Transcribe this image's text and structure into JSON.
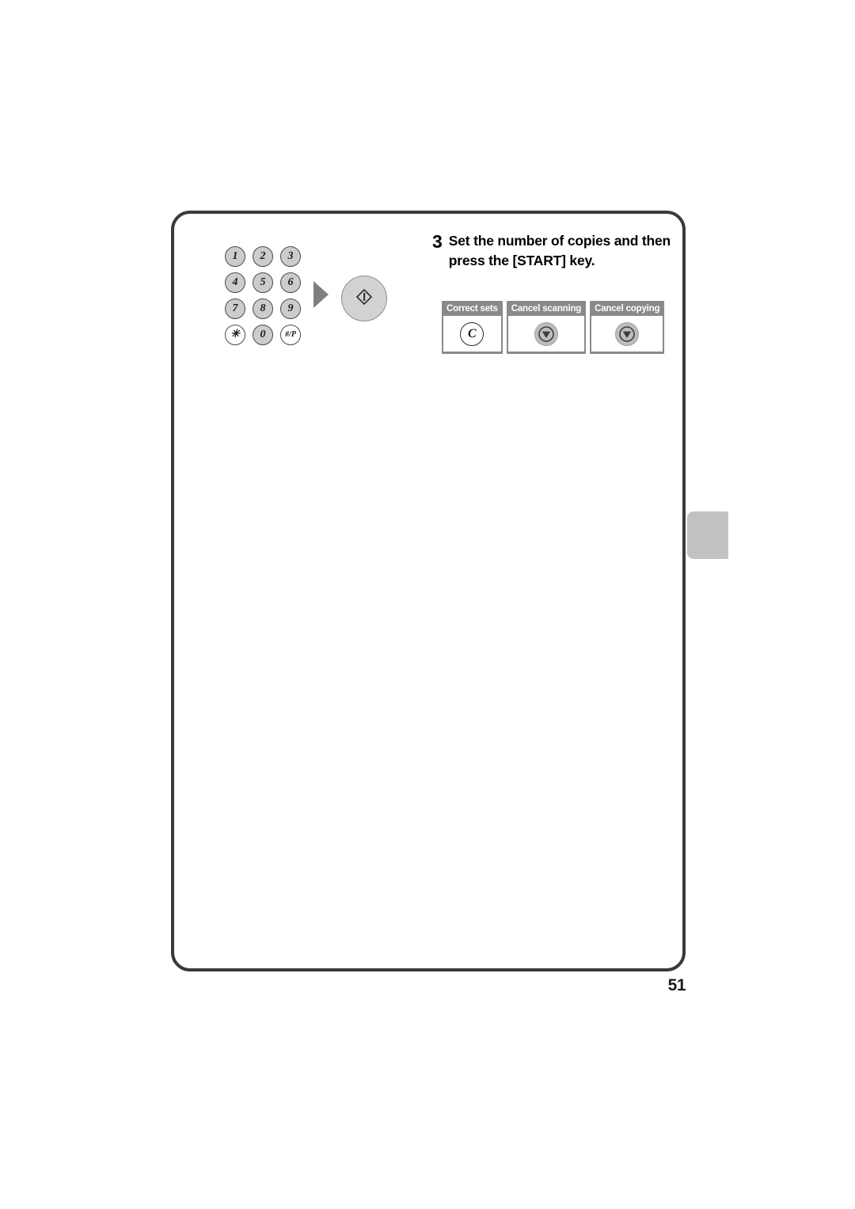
{
  "page": {
    "number": "51"
  },
  "step": {
    "number": "3",
    "instruction": "Set the number of copies and then press the [START] key."
  },
  "keypad": {
    "keys": [
      {
        "label": "1",
        "style": "gray"
      },
      {
        "label": "2",
        "style": "gray"
      },
      {
        "label": "3",
        "style": "gray"
      },
      {
        "label": "4",
        "style": "gray"
      },
      {
        "label": "5",
        "style": "gray"
      },
      {
        "label": "6",
        "style": "gray"
      },
      {
        "label": "7",
        "style": "gray"
      },
      {
        "label": "8",
        "style": "gray"
      },
      {
        "label": "9",
        "style": "gray"
      },
      {
        "label": "✳",
        "style": "white"
      },
      {
        "label": "0",
        "style": "gray"
      },
      {
        "label": "#/P",
        "style": "white"
      }
    ]
  },
  "start_button": {
    "icon": "start-diamond-icon"
  },
  "function_boxes": [
    {
      "label": "Correct sets",
      "icon": "clear-c-icon",
      "icon_text": "C"
    },
    {
      "label": "Cancel scanning",
      "icon": "stop-icon",
      "icon_text": ""
    },
    {
      "label": "Cancel copying",
      "icon": "stop-icon",
      "icon_text": ""
    }
  ],
  "colors": {
    "frame_border": "#3a3a3a",
    "key_fill": "#cccccc",
    "box_header": "#8a8a8a",
    "arrow": "#7d7f82",
    "tab": "#c2c2c2"
  }
}
